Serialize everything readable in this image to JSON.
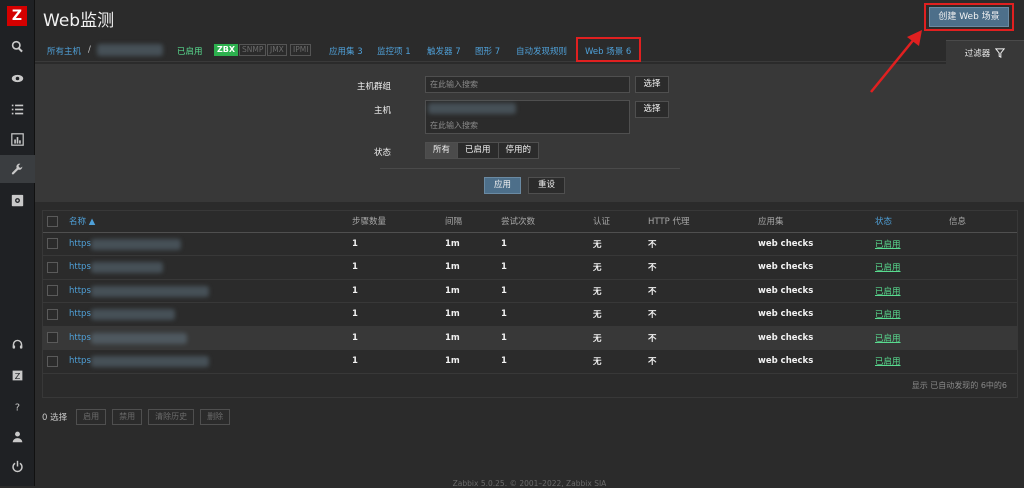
{
  "app": {
    "logo": "Z"
  },
  "sidebar": {
    "items": [
      {
        "icon": "search-icon"
      },
      {
        "icon": "eye-icon"
      },
      {
        "icon": "list-icon"
      },
      {
        "icon": "chart-icon"
      },
      {
        "icon": "wrench-icon"
      },
      {
        "icon": "gear-icon"
      }
    ],
    "bottom": [
      {
        "icon": "headset-icon"
      },
      {
        "icon": "zabbix-share-icon"
      },
      {
        "icon": "help-icon"
      },
      {
        "icon": "user-icon"
      },
      {
        "icon": "power-icon"
      }
    ]
  },
  "header": {
    "title": "Web监测",
    "create_button": "创建 Web 场景"
  },
  "nav": {
    "all_hosts": "所有主机",
    "separator": "/",
    "enabled": "已启用",
    "zbx": "ZBX",
    "protocols": [
      "SNMP",
      "JMX",
      "IPMI"
    ],
    "applications": "应用集 3",
    "items": "监控项 1",
    "triggers": "触发器 7",
    "graphs": "图形 7",
    "discovery": "自动发现规则",
    "web": "Web 场景 6"
  },
  "filter": {
    "tab_label": "过滤器",
    "host_group_label": "主机群组",
    "host_group_placeholder": "在此输入搜索",
    "host_label": "主机",
    "host_placeholder": "在此输入搜索",
    "select_label": "选择",
    "status_label": "状态",
    "status_options": [
      "所有",
      "已启用",
      "停用的"
    ],
    "apply": "应用",
    "reset": "重设"
  },
  "table": {
    "columns": [
      "名称 ▲",
      "步骤数量",
      "间隔",
      "尝试次数",
      "认证",
      "HTTP 代理",
      "应用集",
      "状态",
      "信息"
    ],
    "rows": [
      {
        "name": "https",
        "steps": "1",
        "interval": "1m",
        "attempts": "1",
        "auth": "无",
        "proxy": "不",
        "app": "web checks",
        "status": "已启用"
      },
      {
        "name": "https",
        "steps": "1",
        "interval": "1m",
        "attempts": "1",
        "auth": "无",
        "proxy": "不",
        "app": "web checks",
        "status": "已启用"
      },
      {
        "name": "https",
        "steps": "1",
        "interval": "1m",
        "attempts": "1",
        "auth": "无",
        "proxy": "不",
        "app": "web checks",
        "status": "已启用"
      },
      {
        "name": "https",
        "steps": "1",
        "interval": "1m",
        "attempts": "1",
        "auth": "无",
        "proxy": "不",
        "app": "web checks",
        "status": "已启用"
      },
      {
        "name": "https",
        "steps": "1",
        "interval": "1m",
        "attempts": "1",
        "auth": "无",
        "proxy": "不",
        "app": "web checks",
        "status": "已启用"
      },
      {
        "name": "https",
        "steps": "1",
        "interval": "1m",
        "attempts": "1",
        "auth": "无",
        "proxy": "不",
        "app": "web checks",
        "status": "已启用"
      }
    ],
    "summary": "显示 已自动发现的 6中的6"
  },
  "mass": {
    "selected": "0 选择",
    "buttons": [
      "启用",
      "禁用",
      "清除历史",
      "删除"
    ]
  },
  "footer": {
    "text": "Zabbix 5.0.25. © 2001–2022, Zabbix SIA"
  },
  "colors": {
    "accent_red": "#e02020",
    "link": "#4fa0d8",
    "enabled": "#59db8f",
    "primary_button": "#4d6f8a"
  }
}
